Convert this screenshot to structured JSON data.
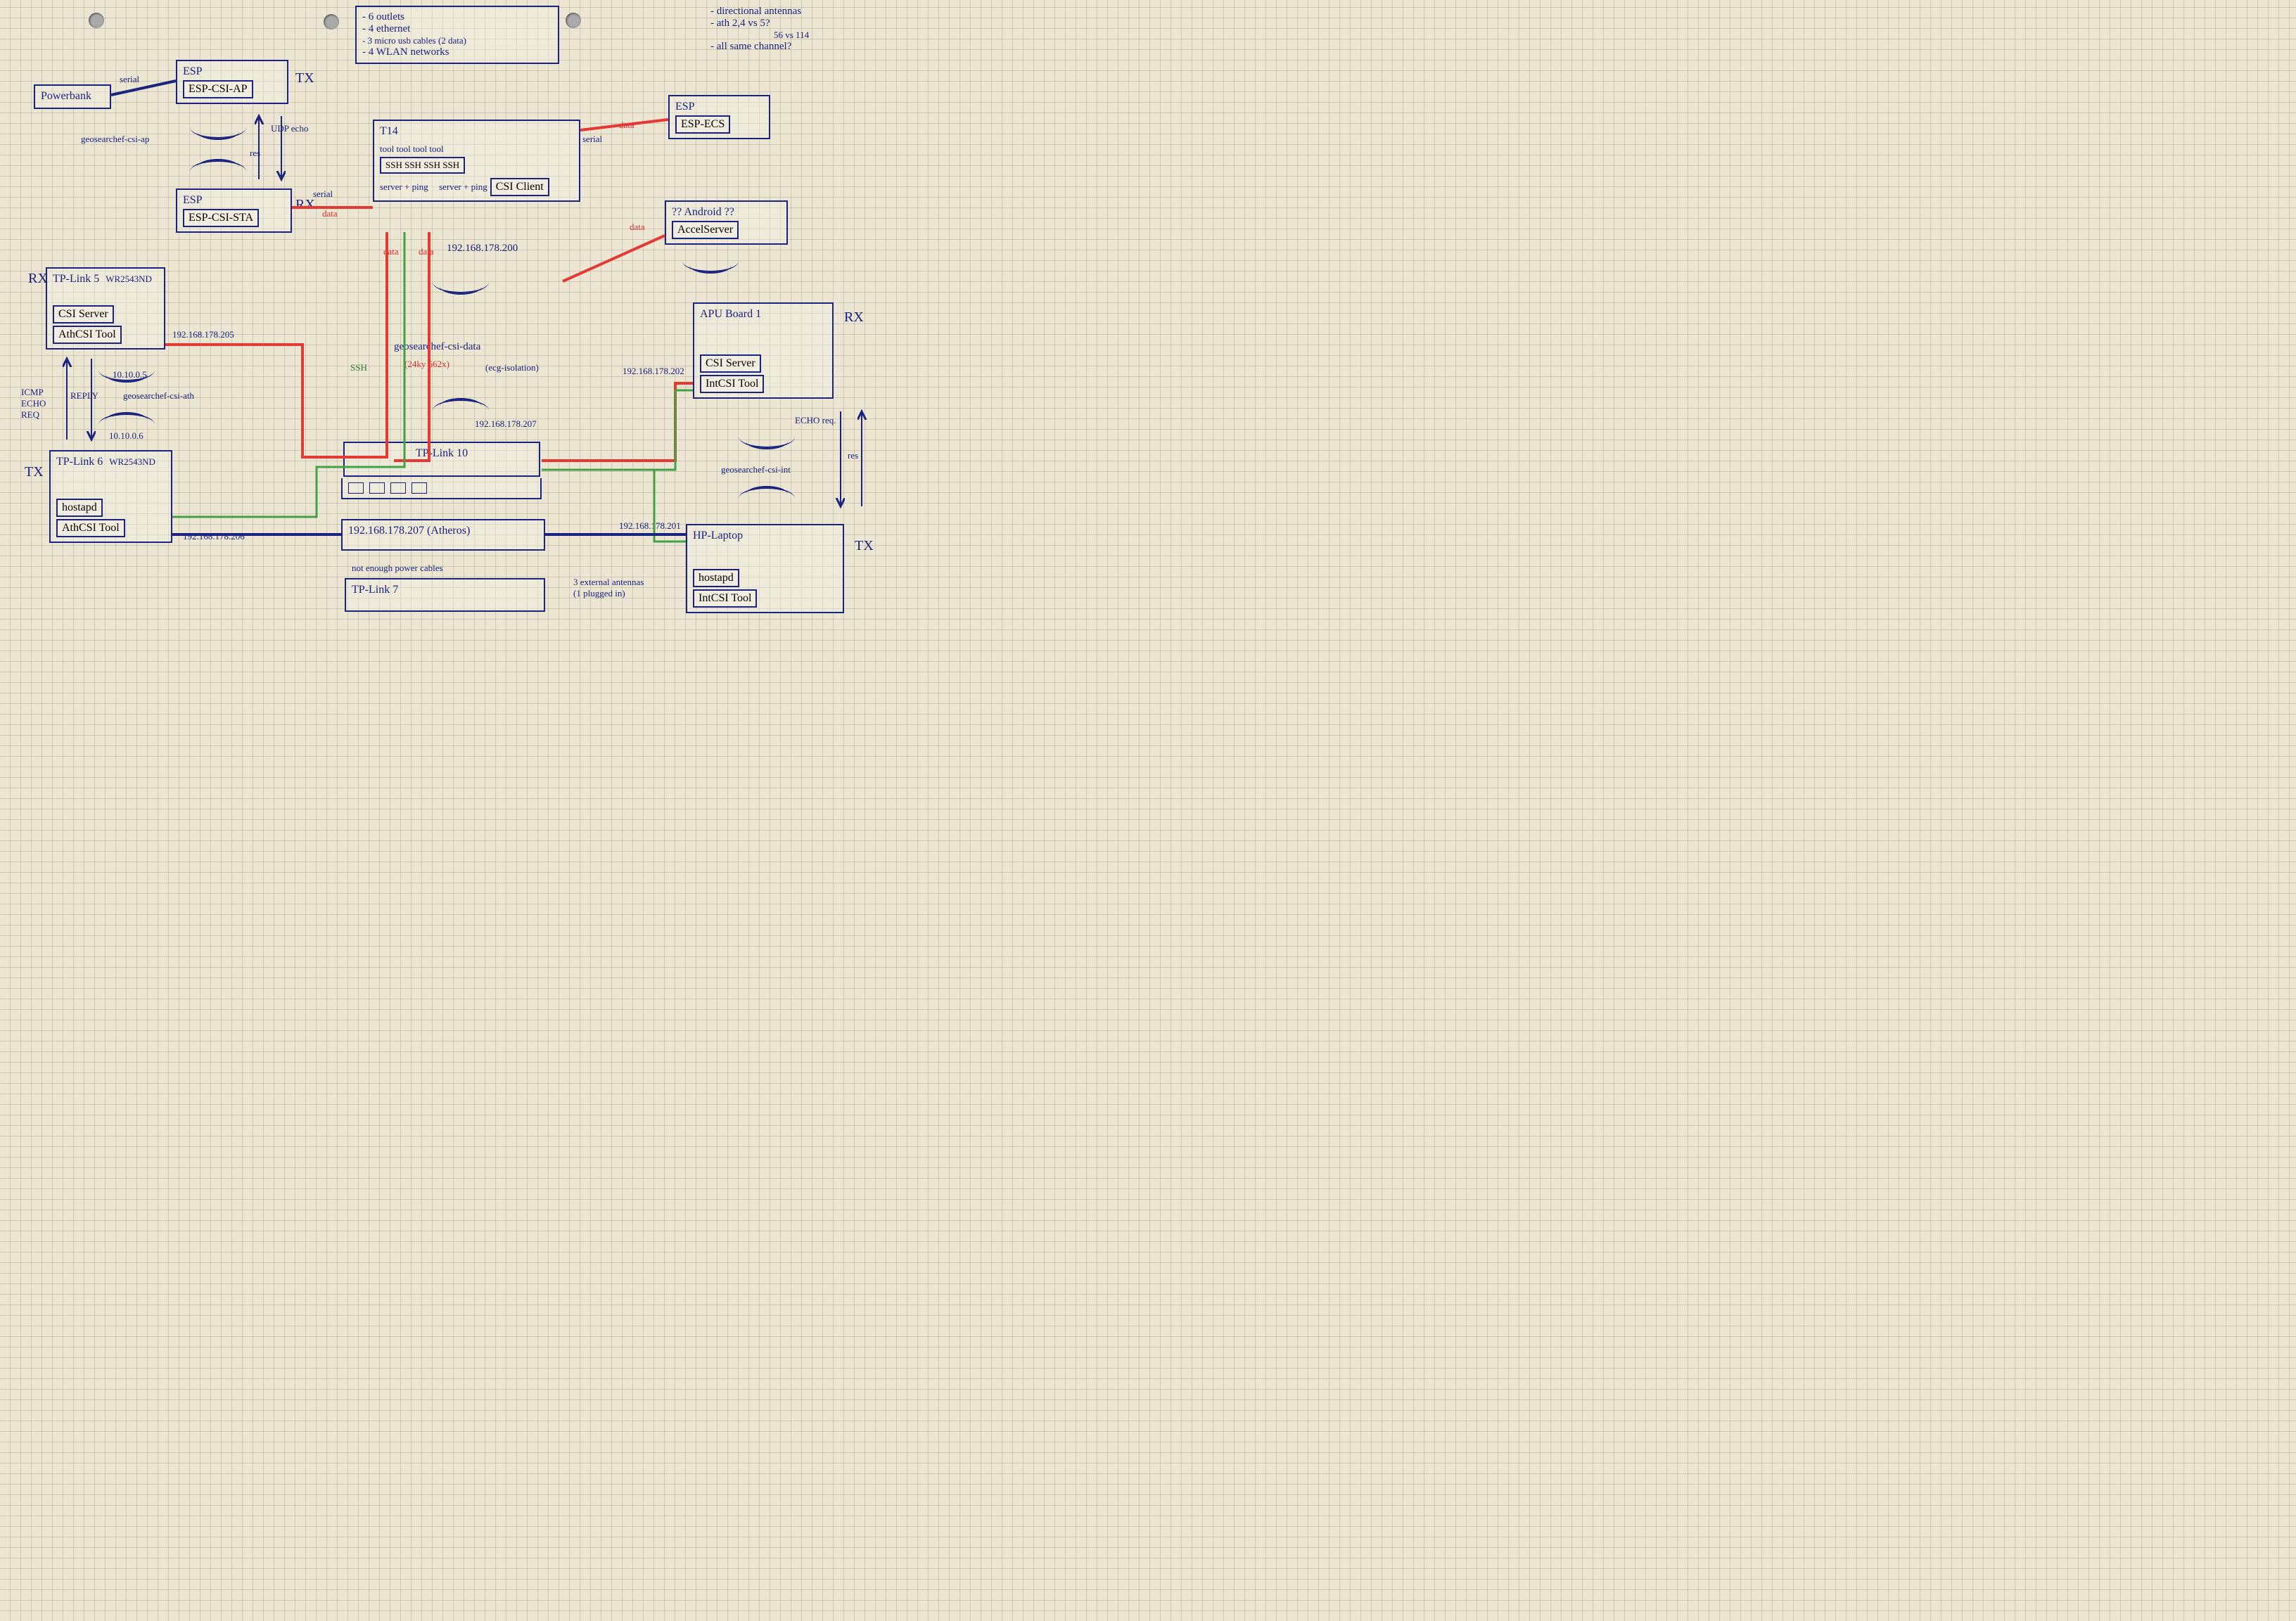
{
  "requirements": {
    "line1": "- 6 outlets",
    "line2": "- 4 ethernet",
    "line3": "- 3 micro usb cables (2 data)",
    "line4": "- 4 WLAN networks"
  },
  "questions": {
    "line1": "- directional antennas",
    "line2": "- ath 2,4 vs 5?",
    "line2b": "56 vs 114",
    "line3": "- all same channel?"
  },
  "powerbank": {
    "name": "Powerbank"
  },
  "esp_tx": {
    "name": "ESP",
    "module": "ESP-CSI-AP",
    "role": "TX",
    "link": "serial"
  },
  "esp_rx": {
    "name": "ESP",
    "module": "ESP-CSI-STA",
    "role": "RX",
    "link": "serial",
    "data": "data"
  },
  "wifi_esp": {
    "ssid": "geosearchef-csi-ap",
    "proto": "UDP echo",
    "res": "res"
  },
  "t14": {
    "name": "T14",
    "tools_header": "tool tool tool tool",
    "ssh_row": "SSH SSH SSH SSH",
    "server_ping": "server + ping",
    "server_ping2": "server + ping",
    "client": "CSI Client",
    "ip": "192.168.178.200",
    "serial": "serial",
    "data1": "data",
    "data2": "data"
  },
  "esp_ecs": {
    "name": "ESP",
    "module": "ESP-ECS",
    "data": "data"
  },
  "android": {
    "name": "?? Android ??",
    "module": "AccelServer",
    "data": "data"
  },
  "tplink5": {
    "name": "TP-Link 5",
    "model": "WR2543ND",
    "role": "RX",
    "svc1": "CSI Server",
    "svc2": "AthCSI Tool",
    "ip_eth": "192.168.178.205",
    "ip_wifi": "10.10.0.5"
  },
  "tplink6": {
    "name": "TP-Link 6",
    "model": "WR2543ND",
    "role": "TX",
    "svc1": "hostapd",
    "svc2": "AthCSI Tool",
    "ip_eth": "192.168.178.206",
    "ip_wifi": "10.10.0.6"
  },
  "wifi_ath": {
    "ssid": "geosearchef-csi-ath",
    "proto1": "ICMP ECHO REQ",
    "proto2": "REPLY"
  },
  "wifi_data": {
    "ssid": "geosearchef-csi-data",
    "note": "(24ky 662x)",
    "isolation": "(ecg-isolation)",
    "router_ip": "192.168.178.207"
  },
  "tplink10": {
    "name": "TP-Link 10"
  },
  "atheros": {
    "ip": "192.168.178.207",
    "label": "(Atheros)"
  },
  "tplink7": {
    "note": "not enough power cables",
    "name": "TP-Link 7",
    "antennas": "3 external antennas (1 plugged in)"
  },
  "apu": {
    "name": "APU Board 1",
    "role": "RX",
    "svc1": "CSI Server",
    "svc2": "IntCSI Tool",
    "ip": "192.168.178.202",
    "echo": "ECHO req.",
    "res": "res"
  },
  "hp": {
    "name": "HP-Laptop",
    "role": "TX",
    "svc1": "hostapd",
    "svc2": "IntCSI Tool",
    "ip": "192.168.178.201"
  },
  "wifi_int": {
    "ssid": "geosearchef-csi-int"
  },
  "ssh_label": "SSH"
}
